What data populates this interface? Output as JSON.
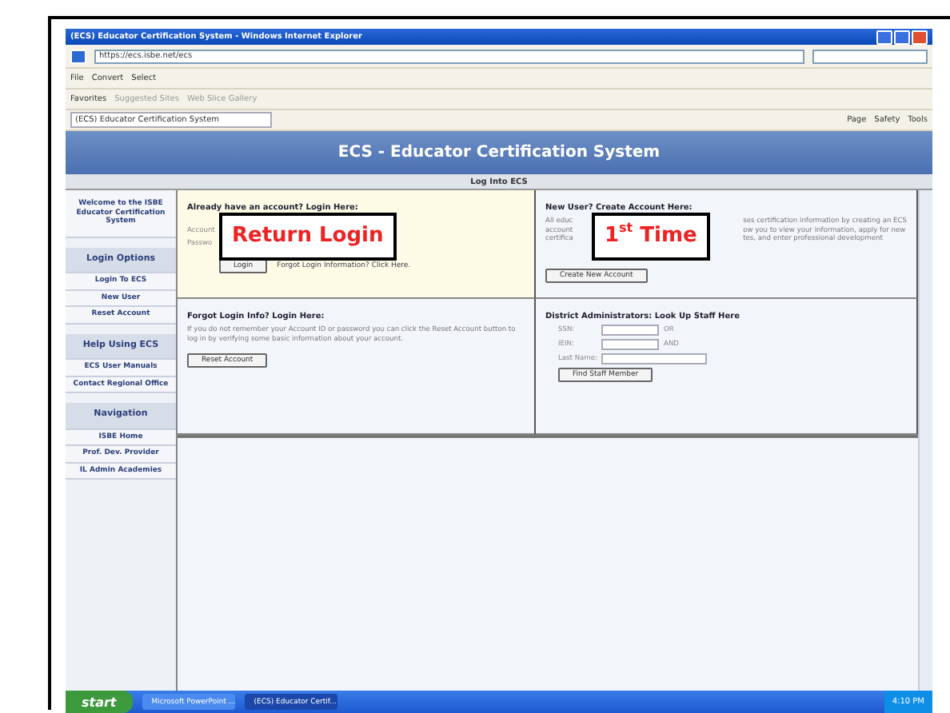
{
  "browser": {
    "title": "(ECS) Educator Certification System - Windows Internet Explorer",
    "address": "https://ecs.isbe.net/ecs",
    "commands": [
      "File",
      "Convert",
      "Select"
    ],
    "favorites": [
      "Favorites",
      "Suggested Sites",
      "Web Slice Gallery"
    ],
    "tab": "(ECS) Educator Certification System",
    "tools": [
      "Page",
      "Safety",
      "Tools"
    ]
  },
  "site": {
    "title": "ECS - Educator Certification System",
    "subtitle": "Log Into ECS"
  },
  "sidebar": [
    {
      "kind": "intro",
      "label": "Welcome to the ISBE Educator Certification System"
    },
    {
      "kind": "heading",
      "label": "Login Options"
    },
    {
      "kind": "link",
      "label": "Login To ECS"
    },
    {
      "kind": "link",
      "label": "New User"
    },
    {
      "kind": "link",
      "label": "Reset Account"
    },
    {
      "kind": "heading",
      "label": "Help Using ECS"
    },
    {
      "kind": "link",
      "label": "ECS User Manuals"
    },
    {
      "kind": "link",
      "label": "Contact Regional Office"
    },
    {
      "kind": "heading",
      "label": "Navigation"
    },
    {
      "kind": "link",
      "label": "ISBE Home"
    },
    {
      "kind": "link",
      "label": "Prof. Dev. Provider"
    },
    {
      "kind": "link",
      "label": "IL Admin Academies"
    }
  ],
  "login": {
    "heading": "Already have an account? Login Here:",
    "labels": [
      "Account",
      "Passwo"
    ],
    "button": "Login",
    "link": "Forgot Login Information? Click Here."
  },
  "new_user": {
    "heading": "New User? Create Account Here:",
    "lines_left": [
      "All educ",
      "account",
      "certifica"
    ],
    "lines_right": [
      "ses certification information by creating an ECS",
      "ow you to view your information, apply for new",
      "tes, and enter professional development"
    ],
    "button": "Create New Account"
  },
  "reset": {
    "heading": "Forgot Login Info? Login Here:",
    "text": "If you do not remember your Account ID or password you can click the Reset Account button to log in by verifying some basic information about your account.",
    "button": "Reset Account"
  },
  "staff": {
    "heading": "District Administrators: Look Up Staff Here",
    "fields": [
      {
        "label": "SSN:",
        "suffix": "OR"
      },
      {
        "label": "IEIN:",
        "suffix": "AND"
      },
      {
        "label": "Last Name:"
      }
    ],
    "button": "Find Staff Member"
  },
  "callouts": [
    {
      "text": "Return Login"
    },
    {
      "text": "1$^{st}$ Time"
    }
  ],
  "taskbar": {
    "start": "start",
    "windows": [
      {
        "label": "Microsoft PowerPoint ...",
        "selected": false
      },
      {
        "label": "(ECS) Educator Certif...",
        "selected": true
      }
    ],
    "clock": "4:10 PM"
  }
}
